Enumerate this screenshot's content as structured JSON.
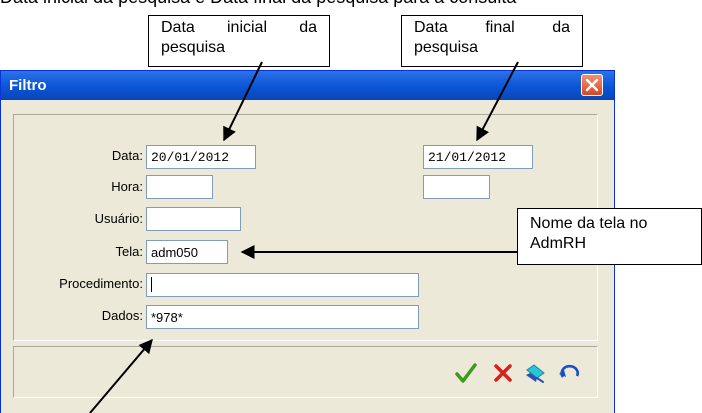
{
  "top_text": "Data inicial da pesquisa e Data final da pesquisa para a consulta",
  "callouts": {
    "initial": "Data inicial da pesquisa",
    "final": "Data final da pesquisa",
    "screen": "Nome da tela no AdmRH"
  },
  "window": {
    "title": "Filtro"
  },
  "form": {
    "date_label": "Data:",
    "date_start": "20/01/2012",
    "date_end": "21/01/2012",
    "time_label": "Hora:",
    "time_start": "",
    "time_end": "",
    "user_label": "Usuário:",
    "user_value": "",
    "screen_label": "Tela:",
    "screen_value": "adm050",
    "procedure_label": "Procedimento:",
    "procedure_value": "",
    "data_label": "Dados:",
    "data_value": "*978*"
  },
  "toolbar": {
    "confirm_icon": "green-check-icon",
    "cancel_icon": "red-x-icon",
    "clear_icon": "eraser-icon",
    "undo_icon": "undo-icon"
  }
}
